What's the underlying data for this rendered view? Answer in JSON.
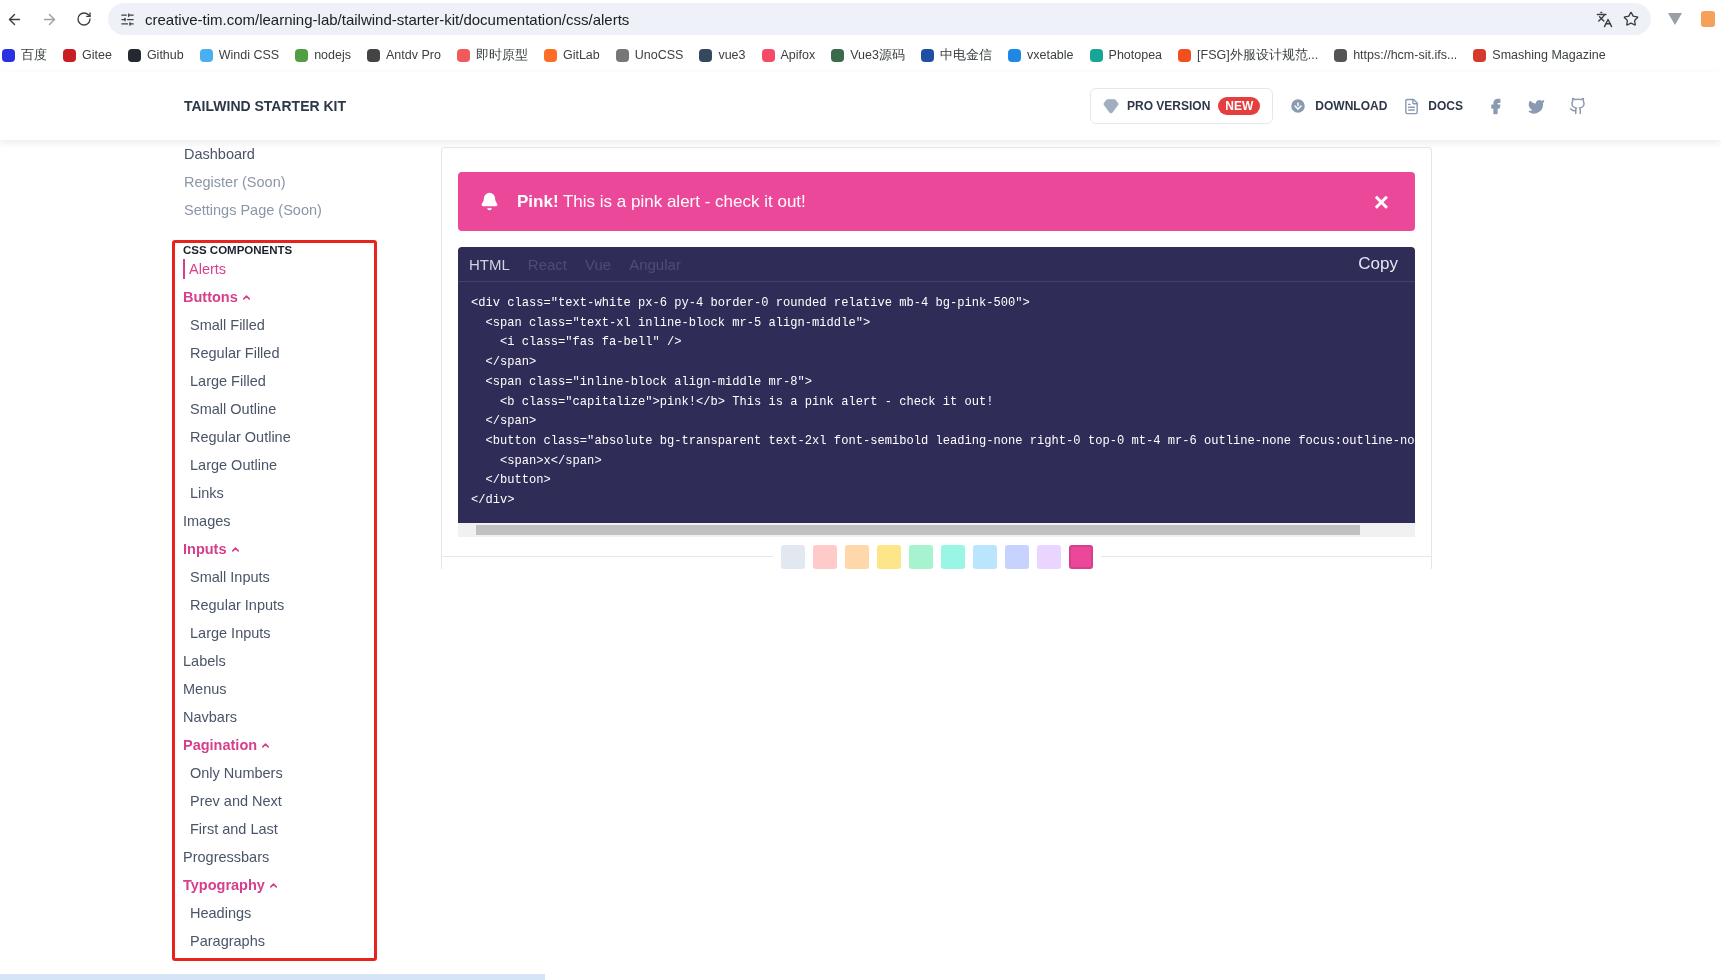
{
  "browser": {
    "url": "creative-tim.com/learning-lab/tailwind-starter-kit/documentation/css/alerts",
    "bookmarks": [
      {
        "label": "百度",
        "color": "#2932e1"
      },
      {
        "label": "Gitee",
        "color": "#c71d23"
      },
      {
        "label": "Github",
        "color": "#24292f"
      },
      {
        "label": "Windi CSS",
        "color": "#48b0f1"
      },
      {
        "label": "nodejs",
        "color": "#539e43"
      },
      {
        "label": "Antdv Pro",
        "color": "#444444"
      },
      {
        "label": "即时原型",
        "color": "#f05a5a"
      },
      {
        "label": "GitLab",
        "color": "#fc6d26"
      },
      {
        "label": "UnoCSS",
        "color": "#777777"
      },
      {
        "label": "vue3",
        "color": "#35495e"
      },
      {
        "label": "Apifox",
        "color": "#f44a66"
      },
      {
        "label": "Vue3源码",
        "color": "#3a6b4a"
      },
      {
        "label": "中电金信",
        "color": "#1d4fa3"
      },
      {
        "label": "vxetable",
        "color": "#1e88e5"
      },
      {
        "label": "Photopea",
        "color": "#18a497"
      },
      {
        "label": "[FSG]外服设计规范...",
        "color": "#f24e1e"
      },
      {
        "label": "https://hcm-sit.ifs...",
        "color": "#555555"
      },
      {
        "label": "Smashing Magazine",
        "color": "#d33a2c"
      }
    ]
  },
  "header": {
    "brand": "TAILWIND STARTER KIT",
    "pro_button": "PRO VERSION",
    "pro_badge": "NEW",
    "download": "DOWNLOAD",
    "docs": "DOCS"
  },
  "sidebar": {
    "top_items": [
      {
        "label": "Dashboard",
        "disabled": false
      },
      {
        "label": "Register (Soon)",
        "disabled": true
      },
      {
        "label": "Settings Page (Soon)",
        "disabled": true
      }
    ],
    "section_title": "CSS COMPONENTS",
    "items": [
      {
        "label": "Alerts",
        "selected": true
      },
      {
        "label": "Buttons",
        "selected": false,
        "expanded": true,
        "children": [
          {
            "label": "Small Filled",
            "selected": false
          },
          {
            "label": "Regular Filled",
            "selected": false
          },
          {
            "label": "Large Filled",
            "selected": false
          },
          {
            "label": "Small Outline",
            "selected": false
          },
          {
            "label": "Regular Outline",
            "selected": false
          },
          {
            "label": "Large Outline",
            "selected": false
          },
          {
            "label": "Links",
            "selected": false
          }
        ]
      },
      {
        "label": "Images",
        "selected": false
      },
      {
        "label": "Inputs",
        "selected": false,
        "expanded": true,
        "children": [
          {
            "label": "Small Inputs",
            "selected": false
          },
          {
            "label": "Regular Inputs",
            "selected": false
          },
          {
            "label": "Large Inputs",
            "selected": false
          }
        ]
      },
      {
        "label": "Labels",
        "selected": false
      },
      {
        "label": "Menus",
        "selected": false
      },
      {
        "label": "Navbars",
        "selected": false
      },
      {
        "label": "Pagination",
        "selected": false,
        "expanded": true,
        "children": [
          {
            "label": "Only Numbers",
            "selected": false
          },
          {
            "label": "Prev and Next",
            "selected": false
          },
          {
            "label": "First and Last",
            "selected": false
          }
        ]
      },
      {
        "label": "Progressbars",
        "selected": false
      },
      {
        "label": "Typography",
        "selected": false,
        "expanded": true,
        "children": [
          {
            "label": "Headings",
            "selected": false
          },
          {
            "label": "Paragraphs",
            "selected": false
          }
        ]
      }
    ]
  },
  "alert": {
    "text": "**Pink!** This is a pink alert - check it out!",
    "close": "×"
  },
  "code": {
    "tabs": [
      {
        "label": "HTML",
        "selected": true
      },
      {
        "label": "React",
        "selected": false
      },
      {
        "label": "Vue",
        "selected": false
      },
      {
        "label": "Angular",
        "selected": false
      }
    ],
    "copy": "Copy",
    "lines": [
      "<div class=\"text-white px-6 py-4 border-0 rounded relative mb-4 bg-pink-500\">",
      "  <span class=\"text-xl inline-block mr-5 align-middle\">",
      "    <i class=\"fas fa-bell\" />",
      "  </span>",
      "  <span class=\"inline-block align-middle mr-8\">",
      "    <b class=\"capitalize\">pink!</b> This is a pink alert - check it out!",
      "  </span>",
      "  <button class=\"absolute bg-transparent text-2xl font-semibold leading-none right-0 top-0 mt-4 mr-6 outline-none focus:outline-no",
      "    <span>x</span>",
      "  </button>",
      "</div>"
    ]
  },
  "swatches": [
    {
      "color": "#e2e8f0",
      "selected": false
    },
    {
      "color": "#fecaca",
      "selected": false
    },
    {
      "color": "#fed7aa",
      "selected": false
    },
    {
      "color": "#fde68a",
      "selected": false
    },
    {
      "color": "#a7f3d0",
      "selected": false
    },
    {
      "color": "#99f6e4",
      "selected": false
    },
    {
      "color": "#bae6fd",
      "selected": false
    },
    {
      "color": "#c7d2fe",
      "selected": false
    },
    {
      "color": "#e9d5ff",
      "selected": false
    },
    {
      "color": "#ec4899",
      "selected": true
    }
  ]
}
